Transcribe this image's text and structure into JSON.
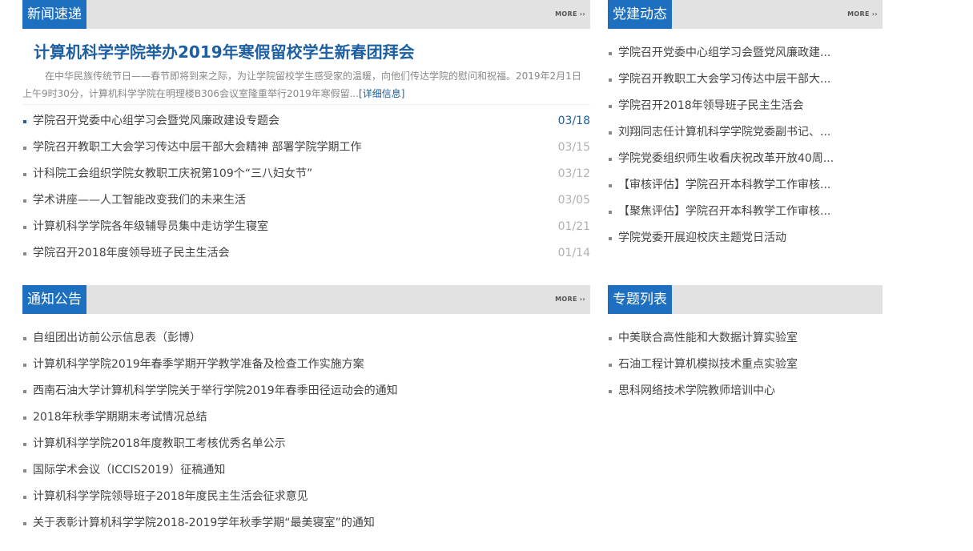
{
  "news": {
    "title": "新闻速递",
    "more": "MORE ››",
    "headline": "计算机科学学院举办2019年寒假留校学生新春团拜会",
    "summary": "在中华民族传统节日——春节即将到来之际，为让学院留校学生感受家的温暖，向他们传达学院的慰问和祝福。2019年2月1日上午9时30分，计算机科学学院在明理楼B306会议室隆重举行2019年寒假留...",
    "detail": "[详细信息]",
    "items": [
      {
        "title": "学院召开党委中心组学习会暨党风廉政建设专题会",
        "date": "03/18"
      },
      {
        "title": "学院召开教职工大会学习传达中层干部大会精神 部署学院学期工作",
        "date": "03/15"
      },
      {
        "title": "计科院工会组织学院女教职工庆祝第109个“三八妇女节”",
        "date": "03/12"
      },
      {
        "title": "学术讲座——人工智能改变我们的未来生活",
        "date": "03/05"
      },
      {
        "title": "计算机科学学院各年级辅导员集中走访学生寝室",
        "date": "01/21"
      },
      {
        "title": "学院召开2018年度领导班子民主生活会",
        "date": "01/14"
      }
    ]
  },
  "party": {
    "title": "党建动态",
    "more": "MORE ››",
    "items": [
      {
        "title": "学院召开党委中心组学习会暨党风廉政建..."
      },
      {
        "title": "学院召开教职工大会学习传达中层干部大..."
      },
      {
        "title": "学院召开2018年领导班子民主生活会"
      },
      {
        "title": "刘翔同志任计算机科学学院党委副书记、..."
      },
      {
        "title": "学院党委组织师生收看庆祝改革开放40周..."
      },
      {
        "title": "【审核评估】学院召开本科教学工作审核..."
      },
      {
        "title": "【聚焦评估】学院召开本科教学工作审核..."
      },
      {
        "title": "学院党委开展迎校庆主题党日活动"
      }
    ]
  },
  "notice": {
    "title": "通知公告",
    "more": "MORE ››",
    "items": [
      {
        "title": "自组团出访前公示信息表（彭博）"
      },
      {
        "title": "计算机科学学院2019年春季学期开学教学准备及检查工作实施方案"
      },
      {
        "title": "西南石油大学计算机科学学院关于举行学院2019年春季田径运动会的通知"
      },
      {
        "title": "2018年秋季学期期末考试情况总结"
      },
      {
        "title": "计算机科学学院2018年度教职工考核优秀名单公示"
      },
      {
        "title": "国际学术会议（ICCIS2019）征稿通知"
      },
      {
        "title": "计算机科学学院领导班子2018年度民主生活会征求意见"
      },
      {
        "title": "关于表彰计算机科学学院2018-2019学年秋季学期“最美寝室”的通知"
      }
    ]
  },
  "topic": {
    "title": "专题列表",
    "items": [
      {
        "title": "中美联合高性能和大数据计算实验室"
      },
      {
        "title": "石油工程计算机模拟技术重点实验室"
      },
      {
        "title": "思科网络技术学院教师培训中心"
      }
    ]
  }
}
